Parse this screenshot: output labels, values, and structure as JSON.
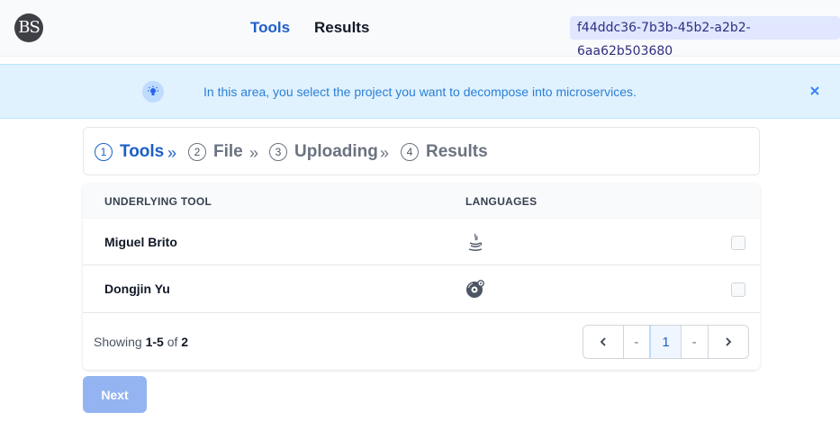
{
  "header": {
    "logo_text": "BS",
    "nav": [
      {
        "label": "Tools"
      },
      {
        "label": "Results"
      }
    ],
    "session_id": "f44ddc36-7b3b-45b2-a2b2-6aa62b503680"
  },
  "banner": {
    "icon": "lightbulb-icon",
    "text": "In this area, you select the project you want to decompose into microservices.",
    "close_icon": "close-icon"
  },
  "stepper": {
    "steps": [
      {
        "num": "1",
        "label": "Tools",
        "active": true
      },
      {
        "num": "2",
        "label": "File",
        "active": false
      },
      {
        "num": "3",
        "label": "Uploading",
        "active": false
      },
      {
        "num": "4",
        "label": "Results",
        "active": false
      }
    ]
  },
  "table": {
    "columns": [
      "UNDERLYING TOOL",
      "LANGUAGES"
    ],
    "rows": [
      {
        "tool": "Miguel Brito",
        "language_icon": "java-icon",
        "checked": false
      },
      {
        "tool": "Dongjin Yu",
        "language_icon": "disc-gear-icon",
        "checked": false
      }
    ],
    "footer": {
      "showing_prefix": "Showing",
      "range": "1-5",
      "of_label": "of",
      "total": "2"
    },
    "pagination": {
      "prev_icon": "chevron-left-icon",
      "items": [
        "-",
        "1",
        "-"
      ],
      "current": "1",
      "next_icon": "chevron-right-icon"
    }
  },
  "actions": {
    "next_label": "Next"
  },
  "colors": {
    "accent": "#1d5ec7",
    "banner_bg": "#e0f2fe",
    "button_disabled": "#93b4f0"
  }
}
